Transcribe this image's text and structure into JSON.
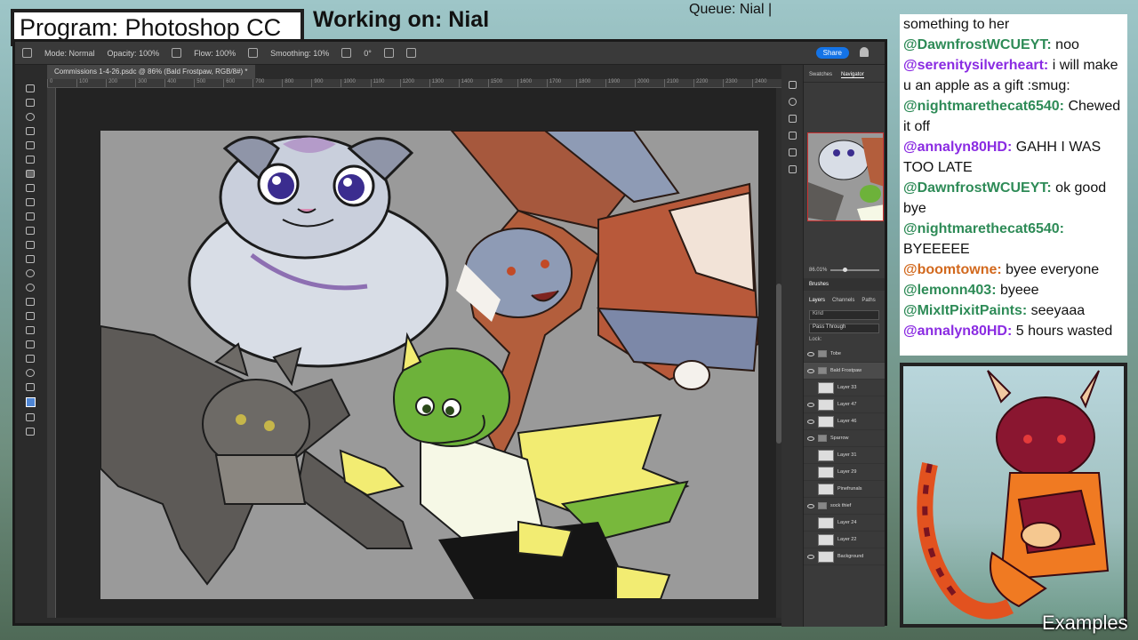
{
  "overlay": {
    "program": "Program: Photoshop CC",
    "working_on": "Working on: Nial",
    "queue": "Queue: Nial |",
    "examples": "Examples"
  },
  "photoshop": {
    "options": {
      "mode": "Mode:",
      "mode_value": "Normal",
      "opacity": "Opacity:",
      "opacity_value": "100%",
      "flow": "Flow:",
      "flow_value": "100%",
      "smoothing": "Smoothing:",
      "smoothing_value": "10%",
      "angle": "0°"
    },
    "share_label": "Share",
    "document_tab": "Commissions 1-4-26.psdc @ 86% (Bald Frostpaw, RGB/8#) *",
    "ruler_ticks": [
      "0",
      "100",
      "200",
      "300",
      "400",
      "500",
      "600",
      "700",
      "800",
      "900",
      "1000",
      "1100",
      "1200",
      "1300",
      "1400",
      "1500",
      "1600",
      "1700",
      "1800",
      "1900",
      "2000",
      "2100",
      "2200",
      "2300",
      "2400"
    ],
    "panels": {
      "top_tabs": [
        "Swatches",
        "Navigator"
      ],
      "zoom": "86.01%",
      "brushes": "Brushes",
      "layers_tabs": [
        "Layers",
        "Channels",
        "Paths"
      ],
      "search_kind": "Kind",
      "blend_mode": "Pass Through",
      "lock": "Lock:",
      "layers": [
        {
          "name": "Tobe",
          "visible": true,
          "folder": true
        },
        {
          "name": "Bald Frostpaw",
          "visible": true,
          "folder": true,
          "selected": true
        },
        {
          "name": "Layer 33",
          "visible": false,
          "folder": false
        },
        {
          "name": "Layer 47",
          "visible": true,
          "folder": false
        },
        {
          "name": "Layer 46",
          "visible": true,
          "folder": false
        },
        {
          "name": "Sparrow",
          "visible": true,
          "folder": true
        },
        {
          "name": "Layer 31",
          "visible": false,
          "folder": false
        },
        {
          "name": "Layer 29",
          "visible": false,
          "folder": false
        },
        {
          "name": "Pinefrunals",
          "visible": false,
          "folder": false
        },
        {
          "name": "sock thief",
          "visible": true,
          "folder": true
        },
        {
          "name": "Layer 24",
          "visible": false,
          "folder": false
        },
        {
          "name": "Layer 22",
          "visible": false,
          "folder": false
        },
        {
          "name": "Background",
          "visible": true,
          "folder": false
        }
      ]
    }
  },
  "chat": {
    "messages": [
      {
        "user": "",
        "text": "something to her"
      },
      {
        "user": "@DawnfrostWCUEYT:",
        "text": "noo",
        "color": "#2e8b57"
      },
      {
        "user": "@serenitysilverheart:",
        "text": "i will make u an apple as a gift :smug:",
        "color": "#8a2be2"
      },
      {
        "user": "@nightmarethecat6540:",
        "text": "Chewed it off",
        "color": "#2e8b57"
      },
      {
        "user": "@annalyn80HD:",
        "text": "GAHH I WAS TOO LATE",
        "color": "#8a2be2"
      },
      {
        "user": "@DawnfrostWCUEYT:",
        "text": "ok good bye",
        "color": "#2e8b57"
      },
      {
        "user": "@nightmarethecat6540:",
        "text": "BYEEEEE",
        "color": "#2e8b57"
      },
      {
        "user": "@boomtowne:",
        "text": "byee everyone",
        "color": "#d2691e"
      },
      {
        "user": "@lemonn403:",
        "text": "byeee",
        "color": "#2e8b57"
      },
      {
        "user": "@MixItPixitPaints:",
        "text": "seeyaaa",
        "color": "#2e8b57"
      },
      {
        "user": "@annalyn80HD:",
        "text": "5 hours wasted",
        "color": "#8a2be2"
      }
    ]
  },
  "colors": {
    "accent_share": "#1473e6",
    "ps_bg": "#2b2b2b",
    "artboard_bg": "#9a9a9a"
  }
}
